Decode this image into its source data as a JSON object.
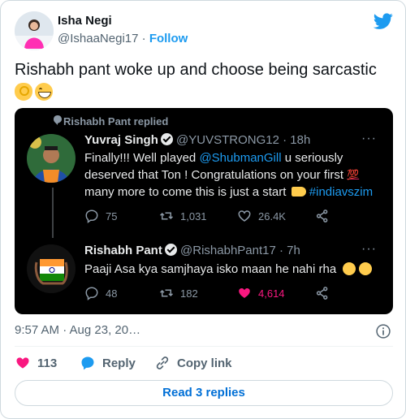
{
  "author": {
    "name": "Isha Negi",
    "handle": "@IshaaNegi17",
    "separator": "·",
    "follow_label": "Follow"
  },
  "tweet": {
    "text": "Rishabh pant woke up and choose being sarcastic",
    "emojis": [
      "ok-hand",
      "grinning-face"
    ]
  },
  "embedded": {
    "replied_label": "Rishabh Pant replied",
    "original": {
      "name": "Yuvraj Singh",
      "handle": "@YUVSTRONG12",
      "age": "· 18h",
      "text_1": "Finally!!!  Well played ",
      "mention": "@ShubmanGill",
      "text_2": " u seriously deserved that Ton ! Congratulations on your first ",
      "hundred_emoji": "💯",
      "text_3": " many more to come this is just a start ",
      "hashtag": "#indiavszim",
      "replies": "75",
      "retweets": "1,031",
      "likes": "26.4K"
    },
    "reply": {
      "name": "Rishabh Pant",
      "handle": "@RishabhPant17",
      "age": "· 7h",
      "text": "Paaji Asa kya samjhaya isko maan he nahi rha",
      "replies": "48",
      "retweets": "182",
      "likes": "4,614"
    }
  },
  "timestamp": "9:57 AM · Aug 23, 20…",
  "footer": {
    "likes": "113",
    "reply_label": "Reply",
    "copy_link_label": "Copy link",
    "read_replies_label": "Read 3 replies"
  },
  "colors": {
    "accent": "#1d9bf0",
    "like": "#f91880",
    "embed_bg": "#000000",
    "muted": "#536471"
  }
}
